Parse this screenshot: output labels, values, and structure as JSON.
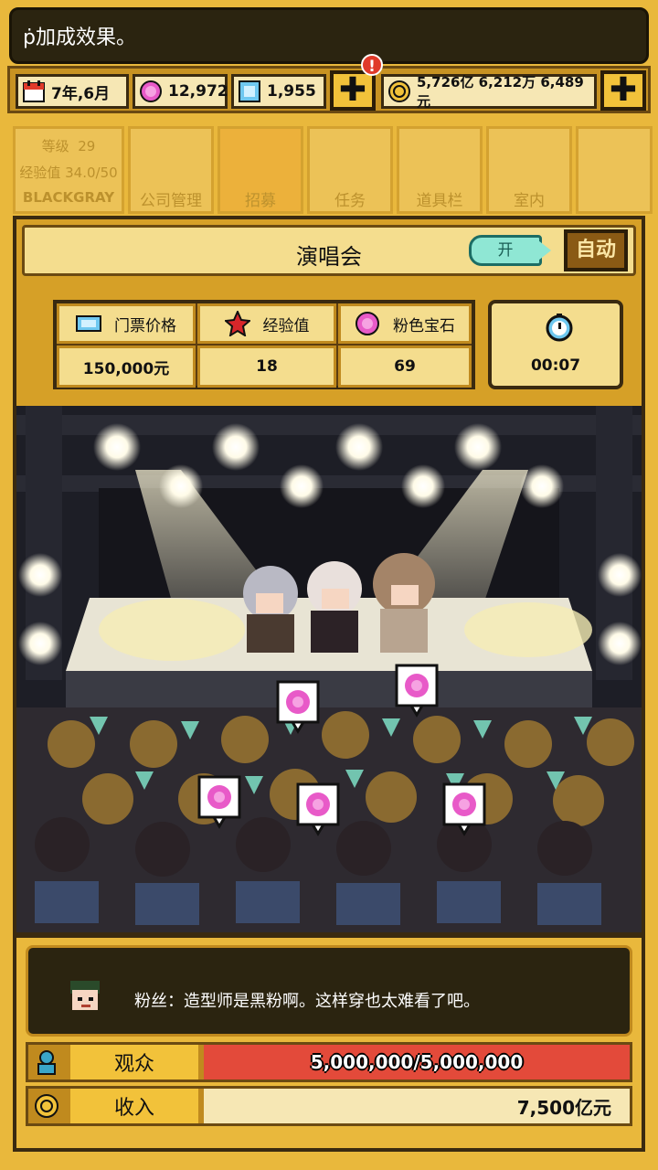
{
  "marquee": {
    "text": "ṗ加成效果。"
  },
  "resources": {
    "date": "7年,6月",
    "pink_gems": "12,972",
    "diamonds": "1,955",
    "alert_badge": "!",
    "money": "5,726亿 6,212万 6,489元",
    "plus_label": "✚"
  },
  "bg_menu": {
    "level_label": "等级",
    "level_value": "29",
    "exp_label": "经验值",
    "exp_value": "34.0/50",
    "company": "BLACKGRAY",
    "tabs": [
      "公司管理",
      "招募",
      "任务",
      "道具栏",
      "室内"
    ]
  },
  "concert": {
    "title": "演唱会",
    "toggle_label": "开",
    "auto_label": "自动",
    "stats": {
      "headers": [
        "门票价格",
        "经验值",
        "粉色宝石"
      ],
      "values": [
        "150,000元",
        "18",
        "69"
      ]
    },
    "timer": "00:07"
  },
  "chat": {
    "message": "粉丝：造型师是黑粉啊。这样穿也太难看了吧。"
  },
  "audience": {
    "label": "观众",
    "value": "5,000,000/5,000,000",
    "fill_fraction": 1.0
  },
  "income": {
    "label": "收入",
    "value": "7,500亿元"
  },
  "colors": {
    "accent": "#e9b83c",
    "bar_red": "#e34a3a",
    "pink_gem": "#e85ac8",
    "toggle": "#8fe7d4"
  }
}
